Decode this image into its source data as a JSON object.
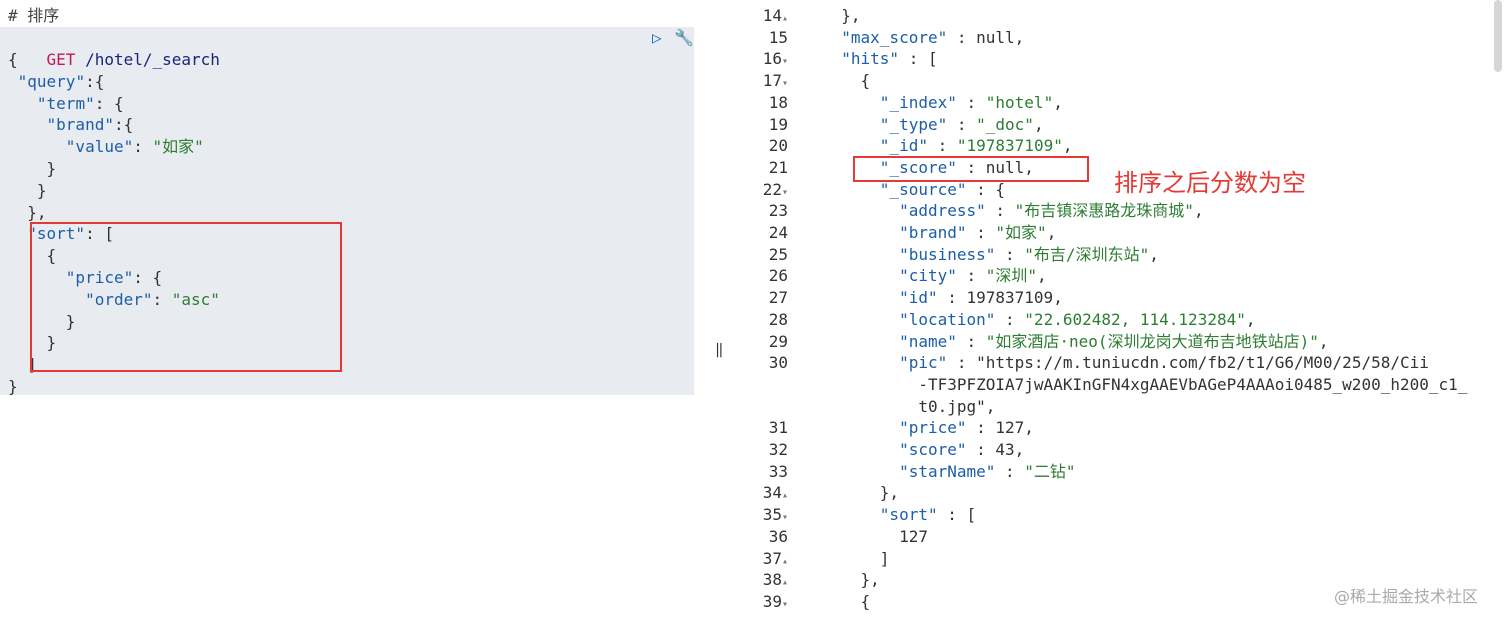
{
  "request": {
    "comment": "# 排序",
    "method": "GET",
    "path": "/hotel/_search",
    "lines": [
      "{",
      " \"query\":{",
      "   \"term\": {",
      "    \"brand\":{",
      "      \"value\": \"如家\"",
      "    }",
      "   }",
      "  },",
      "  \"sort\": [",
      "    {",
      "      \"price\": {",
      "        \"order\": \"asc\"",
      "      }",
      "    }",
      "  ]",
      "}"
    ]
  },
  "annotation": "排序之后分数为空",
  "response": {
    "line_numbers": [
      "14",
      "15",
      "16",
      "17",
      "18",
      "19",
      "20",
      "21",
      "22",
      "23",
      "24",
      "25",
      "26",
      "27",
      "28",
      "29",
      "30",
      "",
      "",
      "31",
      "32",
      "33",
      "34",
      "35",
      "36",
      "37",
      "38",
      "39"
    ],
    "fold_markers": {
      "14": "▴",
      "16": "▾",
      "17": "▾",
      "22": "▾",
      "34": "▴",
      "35": "▾",
      "37": "▴",
      "38": "▴",
      "39": "▾"
    },
    "lines": [
      "  },",
      "  \"max_score\" : null,",
      "  \"hits\" : [",
      "    {",
      "      \"_index\" : \"hotel\",",
      "      \"_type\" : \"_doc\",",
      "      \"_id\" : \"197837109\",",
      "      \"_score\" : null,",
      "      \"_source\" : {",
      "        \"address\" : \"布吉镇深惠路龙珠商城\",",
      "        \"brand\" : \"如家\",",
      "        \"business\" : \"布吉/深圳东站\",",
      "        \"city\" : \"深圳\",",
      "        \"id\" : 197837109,",
      "        \"location\" : \"22.602482, 114.123284\",",
      "        \"name\" : \"如家酒店·neo(深圳龙岗大道布吉地铁站店)\",",
      "        \"pic\" : \"https://m.tuniucdn.com/fb2/t1/G6/M00/25/58/Cii",
      "          -TF3PFZOIA7jwAAKInGFN4xgAAEVbAGeP4AAAoi0485_w200_h200_c1_",
      "          t0.jpg\",",
      "        \"price\" : 127,",
      "        \"score\" : 43,",
      "        \"starName\" : \"二钻\"",
      "      },",
      "      \"sort\" : [",
      "        127",
      "      ]",
      "    },",
      "    {"
    ]
  },
  "toolbar": {
    "run_icon": "play-icon",
    "wrench_icon": "wrench-icon"
  },
  "watermark": "@稀土掘金技术社区",
  "colors": {
    "highlight": "#e8ecf0",
    "box": "#e53935",
    "key": "#1c5ea8",
    "string": "#2e7d32"
  }
}
